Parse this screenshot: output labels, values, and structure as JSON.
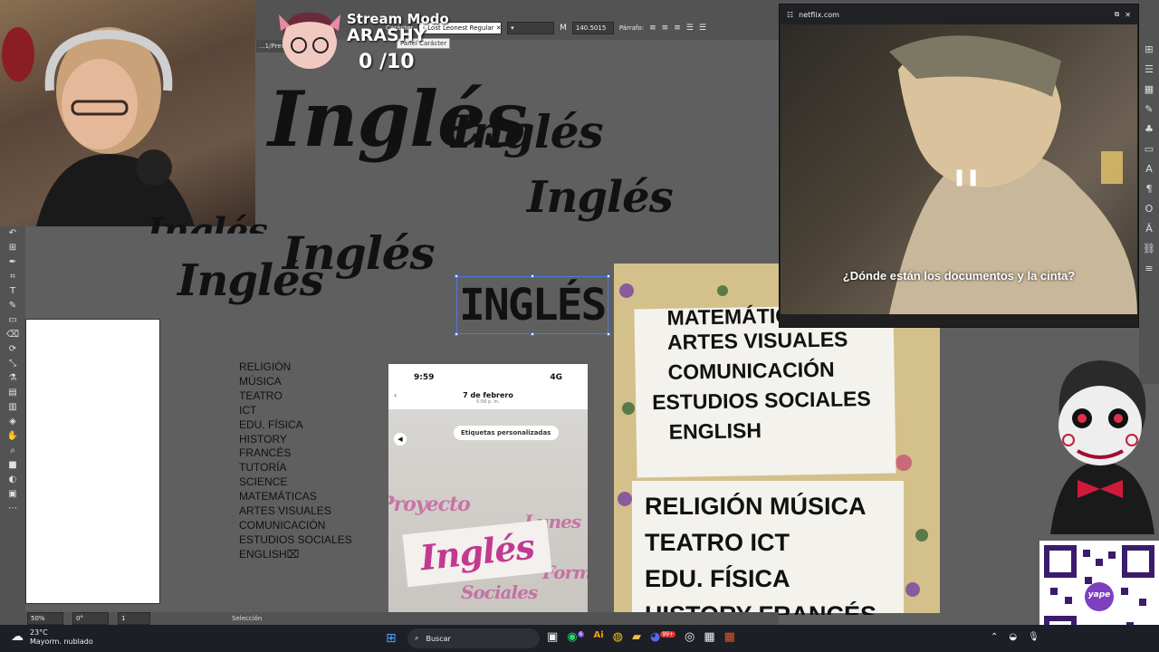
{
  "overlay": {
    "title_line1": "Stream Modo",
    "title_line2": "ARASHY",
    "counter": "0 /10"
  },
  "toolbar": {
    "panel_label": "Carácter",
    "font_name": "Lost Leonest Regular",
    "font_size": "140.5015",
    "paragraph_label": "Párrafo:",
    "tooltip": "Panel Carácter"
  },
  "doc_tab": "...1/Previs...",
  "canvas": {
    "words": [
      "Inglés",
      "Inglés",
      "Inglés",
      "Inglés",
      "Inglés",
      "Inglés"
    ],
    "selected_word": "INGLÉS"
  },
  "subjects": [
    "RELIGIÓN",
    "MÚSICA",
    "TEATRO",
    "ICT",
    "EDU. FÍSICA",
    "HISTORY",
    "FRANCÉS",
    "TUTORÍA",
    "SCIENCE",
    "MATEMÁTICAS",
    "ARTES VISUALES",
    "COMUNICACIÓN",
    "ESTUDIOS SOCIALES",
    "ENGLISH⌧"
  ],
  "phone": {
    "time": "9:59",
    "signal": "4G",
    "date": "7 de febrero",
    "date_sub": "5:56 p. m.",
    "ad_title": "Etiquetas personalizadas",
    "sticker_word": "Inglés",
    "bg_words": [
      "Proyecto",
      "Lunes",
      "Formal",
      "Sociales"
    ]
  },
  "photo": {
    "card1": [
      "MATEMÁTICAS",
      "ARTES VISUALES",
      "COMUNICACIÓN",
      "ESTUDIOS SOCIALES",
      "ENGLISH"
    ],
    "card2": [
      "RELIGIÓN MÚSICA",
      "TEATRO  ICT",
      "EDU. FÍSICA",
      "HISTORY  FRANCÉS"
    ]
  },
  "netflix": {
    "url": "netflix.com",
    "subtitle": "¿Dónde están los documentos y la cinta?"
  },
  "status": {
    "zoom": "50%",
    "rotation": "0°",
    "artboard": "1",
    "mode": "Selección"
  },
  "taskbar": {
    "temp": "23°C",
    "weather": "Mayorm. nublado",
    "search": "Buscar",
    "badge1": "6",
    "badge2": "99+"
  },
  "qr_label": "yape",
  "colors": {
    "ui_dark": "#535353",
    "canvas": "#5f5f5f",
    "selection": "#4a7bd8",
    "sticker_pink": "#c23a8f"
  }
}
